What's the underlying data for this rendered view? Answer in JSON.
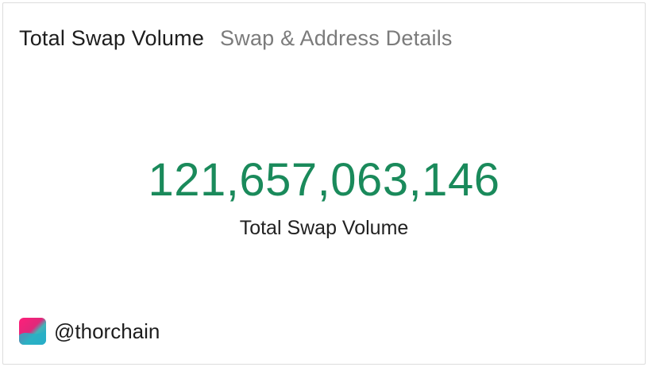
{
  "tabs": [
    {
      "label": "Total Swap Volume",
      "active": true
    },
    {
      "label": "Swap & Address Details",
      "active": false
    }
  ],
  "metric": {
    "value": "121,657,063,146",
    "label": "Total Swap Volume",
    "color": "#1a8a5b"
  },
  "footer": {
    "logo_icon": "thorchain-logo-icon",
    "handle": "@thorchain"
  }
}
